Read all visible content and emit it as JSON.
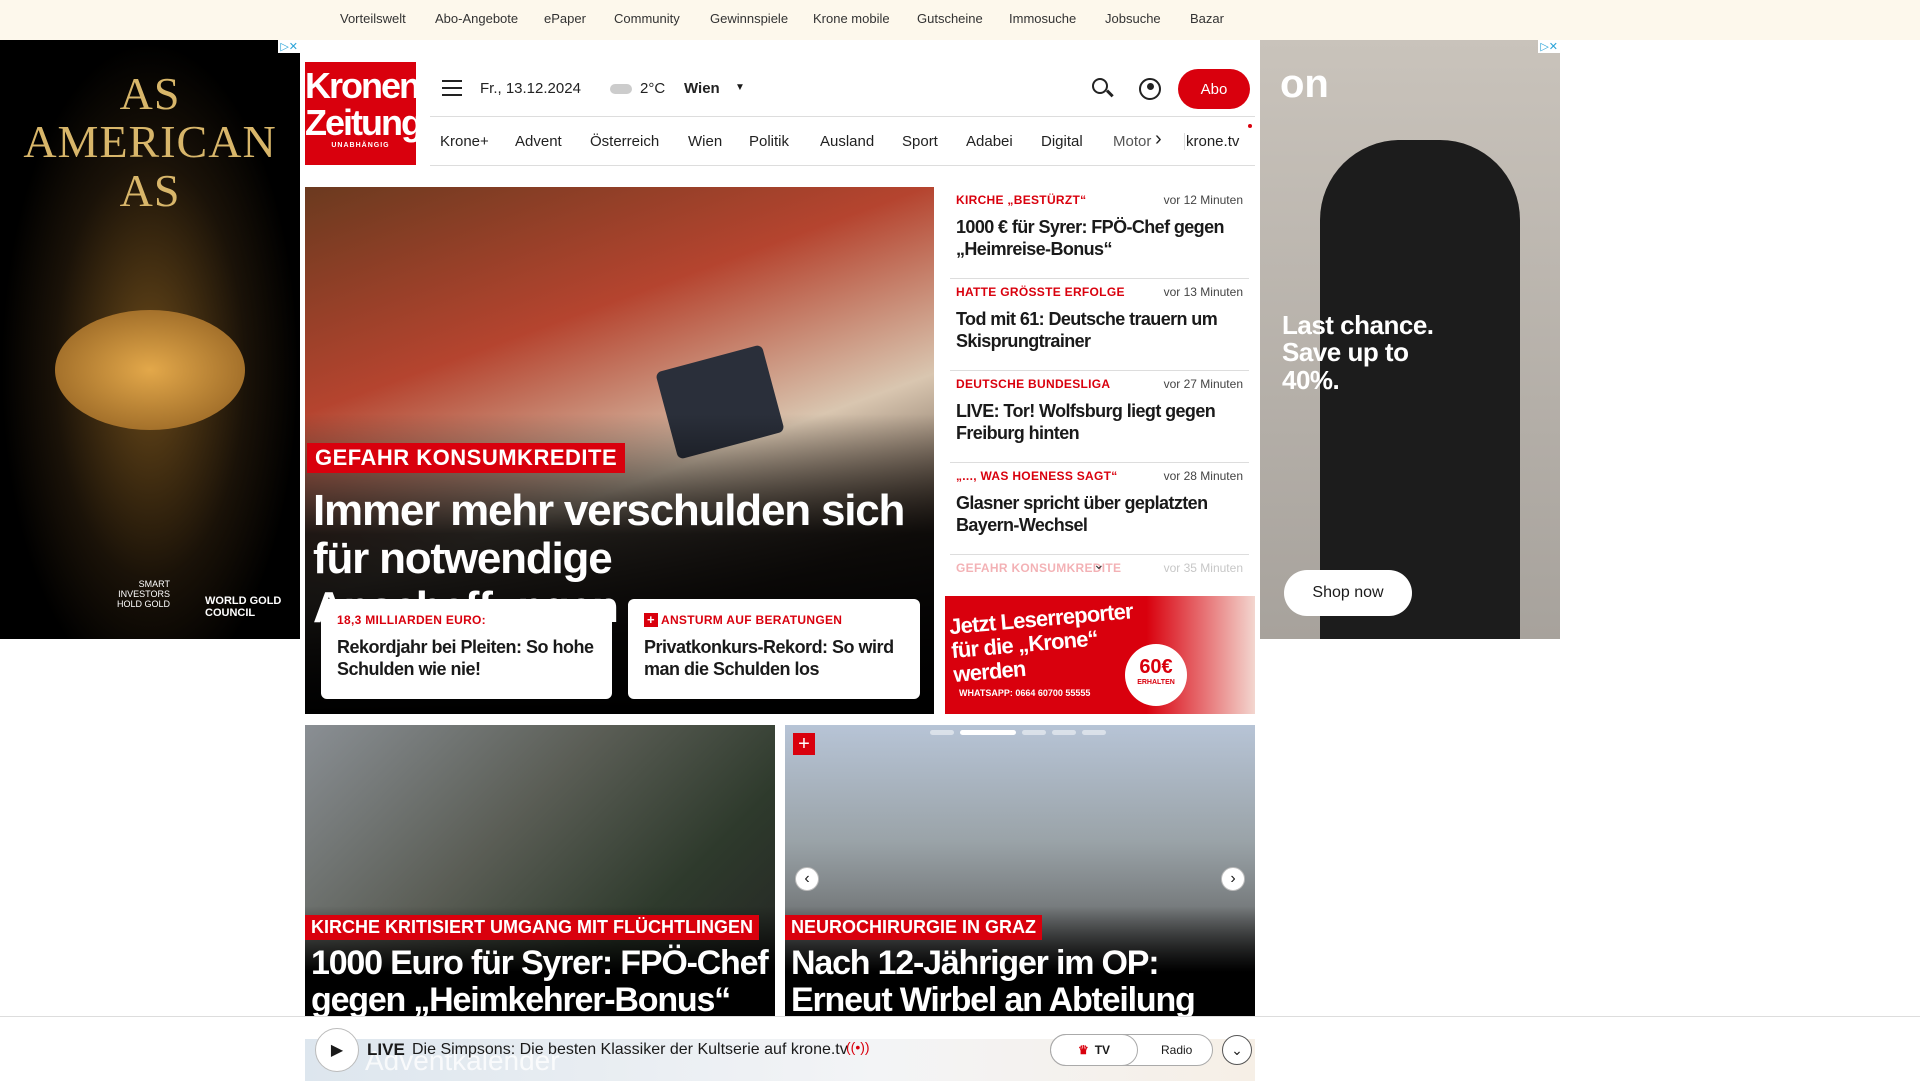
{
  "topnav": [
    "Vorteilswelt",
    "Abo-Angebote",
    "ePaper",
    "Community",
    "Gewinnspiele",
    "Krone mobile",
    "Gutscheine",
    "Immosuche",
    "Jobsuche",
    "Bazar"
  ],
  "left_ad": {
    "text": "AS AMERICAN AS",
    "tagline": "SMART INVESTORS HOLD GOLD",
    "brand": "WORLD GOLD COUNCIL"
  },
  "right_ad": {
    "brand": "on",
    "text": "Last chance. Save up to 40%.",
    "button": "Shop now"
  },
  "logo": {
    "line1": "Kronen",
    "line2": "Zeitung",
    "sub": "UNABHÄNGIG"
  },
  "header": {
    "date": "Fr., 13.12.2024",
    "temp": "2°C",
    "city": "Wien",
    "abo": "Abo"
  },
  "nav": [
    "Krone+",
    "Advent",
    "Österreich",
    "Wien",
    "Politik",
    "Ausland",
    "Sport",
    "Adabei",
    "Digital",
    "Motor",
    "krone.tv"
  ],
  "hero": {
    "kicker": "GEFAHR KONSUMKREDITE",
    "headline": "Immer mehr verschulden sich für notwendige Anschaffungen",
    "cards": [
      {
        "kicker": "18,3 MILLIARDEN EURO:",
        "title": "Rekordjahr bei Pleiten: So hohe Schulden wie nie!"
      },
      {
        "kicker": "ANSTURM AUF BERATUNGEN",
        "title": "Privatkonkurs-Rekord: So wird man die Schulden los",
        "plus": true
      }
    ]
  },
  "news": [
    {
      "kicker": "KIRCHE „BESTÜRZT“",
      "time": "vor 12 Minuten",
      "title": "1000 € für Syrer: FPÖ-Chef gegen „Heimreise-Bonus“"
    },
    {
      "kicker": "HATTE GRÖSSTE ERFOLGE",
      "time": "vor 13 Minuten",
      "title": "Tod mit 61: Deutsche trauern um Skisprungtrainer"
    },
    {
      "kicker": "DEUTSCHE BUNDESLIGA",
      "time": "vor 27 Minuten",
      "title": "LIVE: Tor! Wolfsburg liegt gegen Freiburg hinten"
    },
    {
      "kicker": "„..., WAS HOENESS SAGT“",
      "time": "vor 28 Minuten",
      "title": "Glasner spricht über geplatzten Bayern-Wechsel"
    },
    {
      "kicker": "GEFAHR KONSUMKREDITE",
      "time": "vor 35 Minuten",
      "title": ""
    }
  ],
  "promo": {
    "text": "Jetzt Leserreporter für die „Krone“ werden",
    "whatsapp": "WHATSAPP: 0664 60700 55555",
    "amount": "60€",
    "amount_sub": "ERHALTEN"
  },
  "tiles": [
    {
      "kicker": "KIRCHE KRITISIERT UMGANG MIT FLÜCHTLINGEN",
      "headline": "1000 Euro für Syrer: FPÖ-Chef gegen „Heimkehrer-Bonus“"
    },
    {
      "kicker": "NEUROCHIRURGIE IN GRAZ",
      "headline": "Nach 12-Jähriger im OP: Erneut Wirbel an Abteilung"
    }
  ],
  "player": {
    "live": "LIVE",
    "text": "Die Simpsons: Die besten Klassiker der Kultserie auf krone.tv",
    "tv": "TV",
    "radio": "Radio",
    "bg_text": "Adventkalender"
  },
  "colors": {
    "brand": "#d9000d",
    "topbar": "#fdf8ec"
  }
}
